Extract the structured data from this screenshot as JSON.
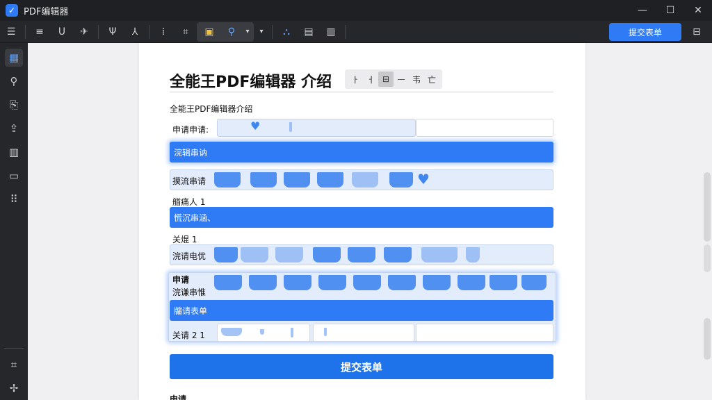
{
  "app": {
    "title": "PDF编辑器",
    "logo_icon": "checkbox-logo-icon"
  },
  "window": {
    "minimize": "—",
    "maximize": "☐",
    "close": "✕"
  },
  "toolbar": {
    "icons": [
      "list-icon",
      "align-icon",
      "underline-icon",
      "bird-icon",
      "text-down-icon",
      "text-slant-icon",
      "columns-icon",
      "crop-icon",
      "highlight-icon",
      "search-icon",
      "dropdown-icon",
      "dropdown-icon",
      "stamp-icon",
      "document-icon",
      "page-icon"
    ],
    "submit_label": "提交表单",
    "right_icon": "settings-icon"
  },
  "sidebar": {
    "items": [
      "calendar-icon",
      "search-icon",
      "export-icon",
      "share-icon",
      "book-icon",
      "screen-icon",
      "grid-icon"
    ],
    "bottom": [
      "text-icon",
      "tools-icon"
    ]
  },
  "document": {
    "title": "全能王PDF编辑器 介绍",
    "mini_toolbar": [
      "ㅏ",
      "ㅓ",
      "⊟",
      "ᅳ",
      "韦",
      "亡"
    ],
    "subtitle": "全能王PDF编辑器介绍",
    "rows": [
      {
        "label": "申请申请:"
      },
      {
        "label": "浣辑串讷"
      },
      {
        "label": "摸流串请"
      },
      {
        "label": "艏痛人 1"
      },
      {
        "label": "慌沉串涵、"
      },
      {
        "label": "关焜 1"
      },
      {
        "label": "浣请电优"
      },
      {
        "label": "申请"
      },
      {
        "label": "浣谦串惟"
      },
      {
        "label": "牖请表单"
      },
      {
        "label": "关请 2 1"
      }
    ],
    "submit_label": "提交表单",
    "bottom_label": "申请"
  }
}
